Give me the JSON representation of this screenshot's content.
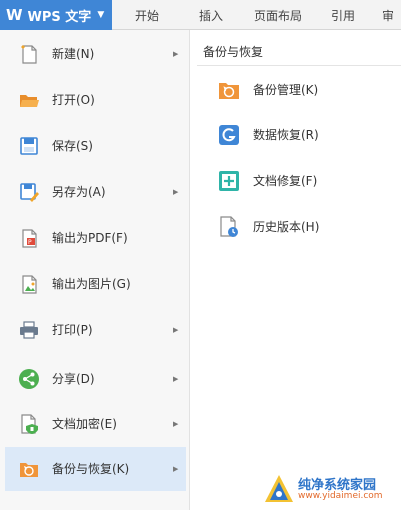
{
  "app_button": {
    "logo": "W",
    "label": "WPS 文字",
    "caret_icon": "caret-down-icon"
  },
  "ribbon_tabs": [
    "开始",
    "插入",
    "页面布局",
    "引用",
    "审"
  ],
  "menu": {
    "items": [
      {
        "label": "新建(N)",
        "icon": "new-doc-icon",
        "submenu": true
      },
      {
        "label": "打开(O)",
        "icon": "open-folder-icon",
        "submenu": false
      },
      {
        "label": "保存(S)",
        "icon": "save-icon",
        "submenu": false
      },
      {
        "label": "另存为(A)",
        "icon": "save-as-icon",
        "submenu": true
      },
      {
        "label": "输出为PDF(F)",
        "icon": "pdf-icon",
        "submenu": false
      },
      {
        "label": "输出为图片(G)",
        "icon": "image-export-icon",
        "submenu": false
      },
      {
        "label": "打印(P)",
        "icon": "print-icon",
        "submenu": true
      },
      {
        "label": "分享(D)",
        "icon": "share-icon",
        "submenu": true
      },
      {
        "label": "文档加密(E)",
        "icon": "encrypt-icon",
        "submenu": true
      },
      {
        "label": "备份与恢复(K)",
        "icon": "backup-icon",
        "submenu": true,
        "active": true
      }
    ]
  },
  "submenu": {
    "title": "备份与恢复",
    "items": [
      {
        "label": "备份管理(K)",
        "icon": "backup-manage-icon"
      },
      {
        "label": "数据恢复(R)",
        "icon": "data-recovery-icon"
      },
      {
        "label": "文档修复(F)",
        "icon": "doc-repair-icon"
      },
      {
        "label": "历史版本(H)",
        "icon": "history-version-icon"
      }
    ]
  },
  "watermark": {
    "name": "纯净系统家园",
    "url": "www.yidaimei.com"
  },
  "colors": {
    "accent": "#3f86d6",
    "active_bg": "#dce9f8",
    "menu_bg": "#f7f7f7"
  }
}
